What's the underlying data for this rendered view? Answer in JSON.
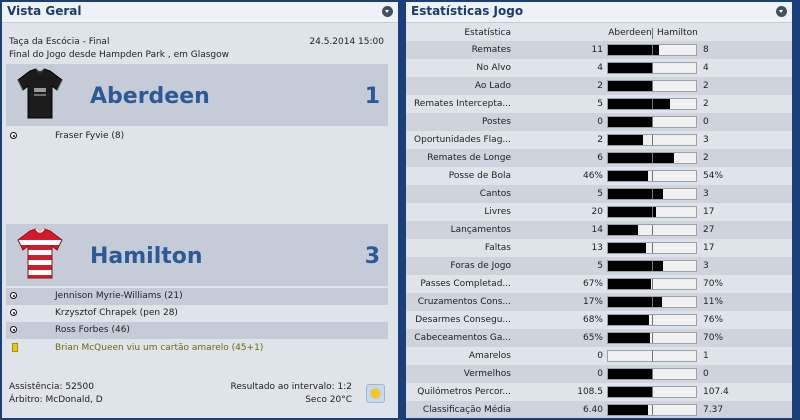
{
  "left_panel": {
    "title": "Vista Geral",
    "competition": "Taça da Escócia - Final",
    "date_time": "24.5.2014 15:00",
    "venue": "Final do Jogo desde Hampden Park , em Glasgow",
    "home": {
      "name": "Aberdeen",
      "score": "1",
      "shirt_icon": "black-shirt-icon",
      "events": [
        {
          "icon": "ball-icon",
          "text": "Fraser Fyvie (8)"
        }
      ]
    },
    "away": {
      "name": "Hamilton",
      "score": "3",
      "shirt_icon": "red-white-hooped-shirt-icon",
      "events": [
        {
          "icon": "ball-icon",
          "text": "Jennison Myrie-Williams (21)"
        },
        {
          "icon": "ball-icon",
          "text": "Krzysztof Chrapek (pen 28)"
        },
        {
          "icon": "ball-icon",
          "text": "Ross Forbes (46)"
        },
        {
          "icon": "yellow-card-icon",
          "text": "Brian McQueen viu um cartão amarelo (45+1)"
        }
      ]
    },
    "attendance": "Assistência: 52500",
    "referee": "Árbitro: McDonald, D",
    "halftime": "Resultado ao intervalo: 1:2",
    "weather": "Seco 20°C",
    "weather_icon": "sun-icon"
  },
  "right_panel": {
    "title": "Estatísticas Jogo",
    "header": {
      "stat": "Estatística",
      "home": "Aberdeen",
      "away": "Hamilton"
    },
    "rows": [
      {
        "label": "Remates",
        "home": "11",
        "away": "8",
        "home_share": 0.58
      },
      {
        "label": "No Alvo",
        "home": "4",
        "away": "4",
        "home_share": 0.5
      },
      {
        "label": "Ao Lado",
        "home": "2",
        "away": "2",
        "home_share": 0.5
      },
      {
        "label": "Remates Intercepta...",
        "home": "5",
        "away": "2",
        "home_share": 0.71
      },
      {
        "label": "Postes",
        "home": "0",
        "away": "0",
        "home_share": 0.5
      },
      {
        "label": "Oportunidades Flag...",
        "home": "2",
        "away": "3",
        "home_share": 0.4
      },
      {
        "label": "Remates de Longe",
        "home": "6",
        "away": "2",
        "home_share": 0.75
      },
      {
        "label": "Posse de Bola",
        "home": "46%",
        "away": "54%",
        "home_share": 0.46
      },
      {
        "label": "Cantos",
        "home": "5",
        "away": "3",
        "home_share": 0.63
      },
      {
        "label": "Livres",
        "home": "20",
        "away": "17",
        "home_share": 0.54
      },
      {
        "label": "Lançamentos",
        "home": "14",
        "away": "27",
        "home_share": 0.34
      },
      {
        "label": "Faltas",
        "home": "13",
        "away": "17",
        "home_share": 0.43
      },
      {
        "label": "Foras de Jogo",
        "home": "5",
        "away": "3",
        "home_share": 0.63
      },
      {
        "label": "Passes Completad...",
        "home": "67%",
        "away": "70%",
        "home_share": 0.49
      },
      {
        "label": "Cruzamentos Cons...",
        "home": "17%",
        "away": "11%",
        "home_share": 0.61
      },
      {
        "label": "Desarmes Consegu...",
        "home": "68%",
        "away": "76%",
        "home_share": 0.47
      },
      {
        "label": "Cabeceamentos Ga...",
        "home": "65%",
        "away": "70%",
        "home_share": 0.48
      },
      {
        "label": "Amarelos",
        "home": "0",
        "away": "1",
        "home_share": 0.0
      },
      {
        "label": "Vermelhos",
        "home": "0",
        "away": "0",
        "home_share": 0.5
      },
      {
        "label": "Quilómetros Percor...",
        "home": "108.5",
        "away": "107.4",
        "home_share": 0.5
      },
      {
        "label": "Classificação Média",
        "home": "6.40",
        "away": "7.37",
        "home_share": 0.46
      }
    ]
  }
}
